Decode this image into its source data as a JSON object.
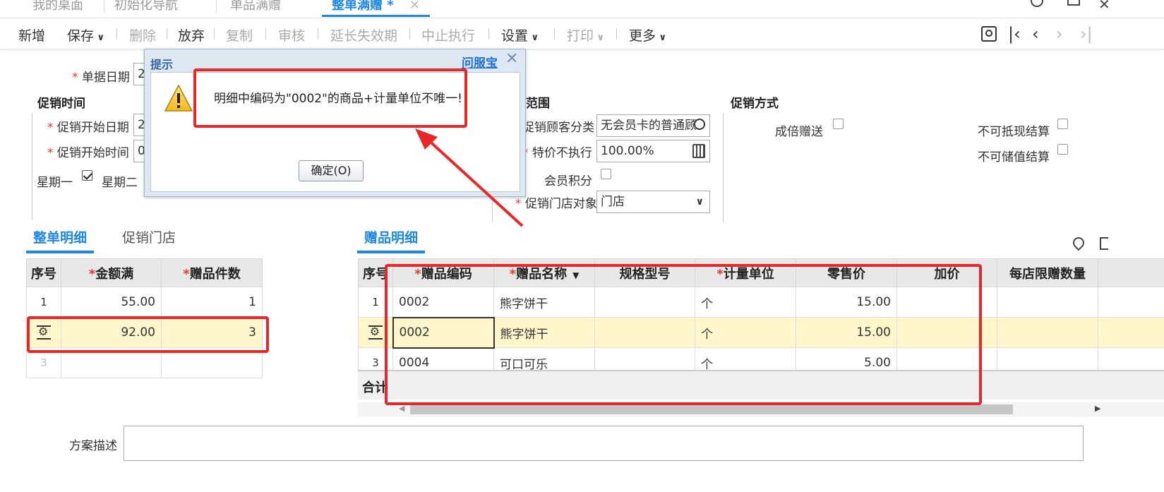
{
  "tabs": [
    {
      "label": "我的桌面"
    },
    {
      "label": "初始化导航"
    },
    {
      "label": "单品满赠"
    },
    {
      "label": "整单满赠 *"
    }
  ],
  "toolbar": {
    "add": "新增",
    "save": "保存",
    "delete": "删除",
    "abandon": "放弃",
    "copy": "复制",
    "audit": "审核",
    "extend": "延长失效期",
    "stop": "中止执行",
    "settings": "设置",
    "print": "打印",
    "more": "更多"
  },
  "form": {
    "doc_date_label": "单据日期",
    "doc_date_value": "2",
    "promo_time_heading": "促销时间",
    "start_date_label": "促销开始日期",
    "start_date_value": "2",
    "start_time_label": "促销开始时间",
    "start_time_value": "0",
    "monday_label": "星期一",
    "tuesday_label": "星期二",
    "scope_heading": "范围",
    "customer_class_label": "促销顾客分类",
    "customer_class_value": "无会员卡的普通顾",
    "special_price_label": "特价不执行",
    "special_price_value": "100.00%",
    "member_points_label": "会员积分",
    "store_target_label": "促销门店对象",
    "store_target_value": "门店",
    "promo_mode_heading": "促销方式",
    "multiple_gift_label": "成倍赠送",
    "no_cash_label": "不可抵现结算",
    "no_stored_label": "不可储值结算",
    "plan_desc_label": "方案描述"
  },
  "left_tabs": {
    "detail": "整单明细",
    "stores": "促销门店"
  },
  "left_table": {
    "headers": [
      "序号",
      "金额满",
      "赠品件数"
    ],
    "rows": [
      {
        "idx": "1",
        "amount": "55.00",
        "qty": "1"
      },
      {
        "idx": "",
        "amount": "92.00",
        "qty": "3"
      },
      {
        "idx": "3",
        "amount": "",
        "qty": ""
      }
    ]
  },
  "right_tab": "赠品明细",
  "right_table": {
    "headers": [
      "序号",
      "赠品编码",
      "赠品名称",
      "规格型号",
      "计量单位",
      "零售价",
      "加价",
      "每店限赠数量"
    ],
    "rows": [
      {
        "idx": "1",
        "code": "0002",
        "name": "熊字饼干",
        "spec": "",
        "unit": "个",
        "price": "15.00",
        "markup": "",
        "limit": ""
      },
      {
        "idx": "",
        "code": "0002",
        "name": "熊字饼干",
        "spec": "",
        "unit": "个",
        "price": "15.00",
        "markup": "",
        "limit": ""
      },
      {
        "idx": "3",
        "code": "0004",
        "name": "可口可乐",
        "spec": "",
        "unit": "个",
        "price": "5.00",
        "markup": "",
        "limit": ""
      }
    ],
    "total_label": "合计"
  },
  "dialog": {
    "title": "提示",
    "link": "问服宝",
    "message": "明细中编码为\"0002\"的商品+计量单位不唯一!",
    "ok_button": "确定(O)"
  },
  "colors": {
    "accent": "#1e88e5",
    "highlight": "#e82828",
    "selected_row": "#fff6cc"
  }
}
